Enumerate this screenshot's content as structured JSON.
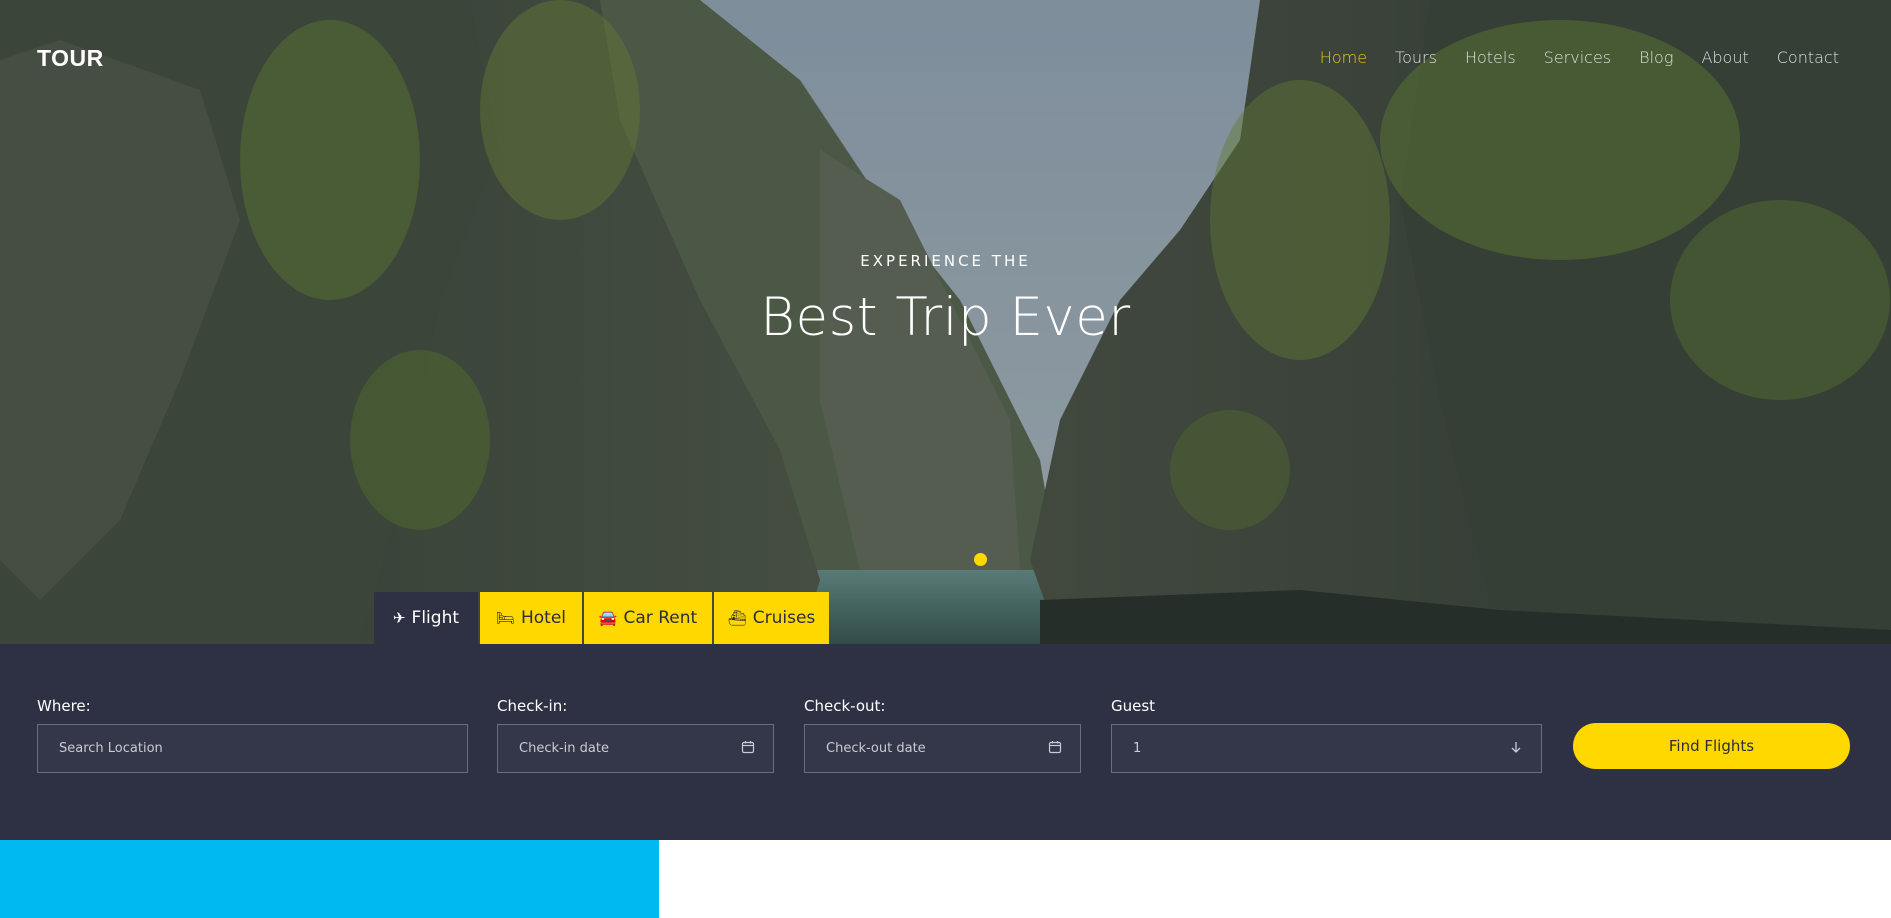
{
  "brand": {
    "logo": "TOUR"
  },
  "nav": {
    "items": [
      {
        "label": "Home",
        "active": true
      },
      {
        "label": "Tours",
        "active": false
      },
      {
        "label": "Hotels",
        "active": false
      },
      {
        "label": "Services",
        "active": false
      },
      {
        "label": "Blog",
        "active": false
      },
      {
        "label": "About",
        "active": false
      },
      {
        "label": "Contact",
        "active": false
      }
    ]
  },
  "hero": {
    "subtitle": "EXPERIENCE THE",
    "title": "Best Trip Ever"
  },
  "tabs": [
    {
      "label": "Flight",
      "icon": "plane-icon",
      "active": true
    },
    {
      "label": "Hotel",
      "icon": "bed-icon",
      "active": false
    },
    {
      "label": "Car Rent",
      "icon": "car-icon",
      "active": false
    },
    {
      "label": "Cruises",
      "icon": "ship-icon",
      "active": false
    }
  ],
  "search": {
    "where": {
      "label": "Where:",
      "placeholder": "Search Location"
    },
    "checkin": {
      "label": "Check-in:",
      "placeholder": "Check-in date",
      "icon": "calendar-icon"
    },
    "checkout": {
      "label": "Check-out:",
      "placeholder": "Check-out date",
      "icon": "calendar-icon"
    },
    "guest": {
      "label": "Guest",
      "value": "1",
      "icon": "arrow-down-icon"
    },
    "submit_label": "Find Flights"
  },
  "colors": {
    "accent": "#ffd800",
    "panel": "#2e3144",
    "blue": "#00b9f0"
  }
}
